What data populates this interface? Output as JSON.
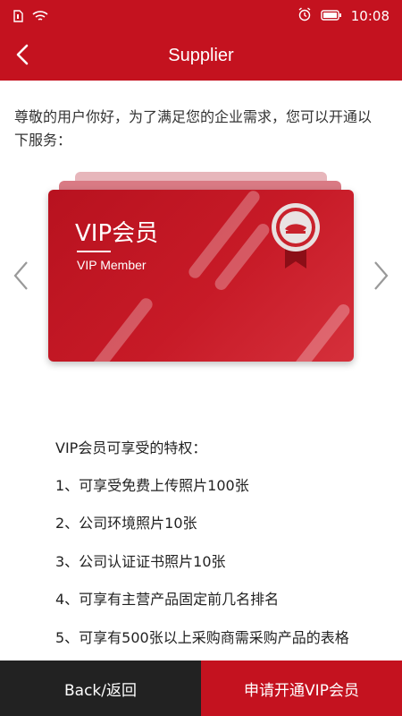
{
  "status_bar": {
    "time": "10:08"
  },
  "header": {
    "title": "Supplier"
  },
  "intro": "尊敬的用户你好，为了满足您的企业需求，您可以开通以 下服务：",
  "card": {
    "title": "VIP会员",
    "subtitle": "VIP Member"
  },
  "privileges": {
    "title": "VIP会员可享受的特权：",
    "items": [
      "1、可享受免费上传照片100张",
      "2、公司环境照片10张",
      "3、公司认证证书照片10张",
      "4、可享有主营产品固定前几名排名",
      "5、可享有500张以上采购商需采购产品的表格"
    ]
  },
  "footer": {
    "back_label": "Back/返回",
    "apply_label": "申请开通VIP会员"
  },
  "colors": {
    "brand_red": "#c4121f",
    "dark": "#222222"
  }
}
